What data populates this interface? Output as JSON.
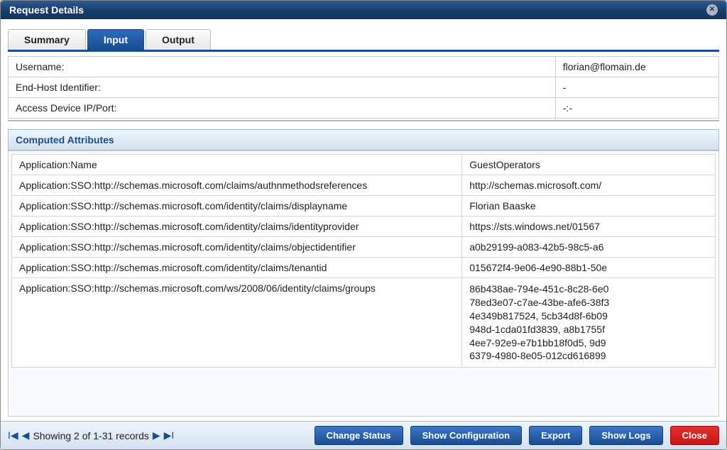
{
  "window": {
    "title": "Request Details"
  },
  "tabs": [
    {
      "label": "Summary",
      "active": false
    },
    {
      "label": "Input",
      "active": true
    },
    {
      "label": "Output",
      "active": false
    }
  ],
  "info": {
    "username_label": "Username:",
    "username_value": "florian@flomain.de",
    "endhost_label": "End-Host Identifier:",
    "endhost_value": "-",
    "device_label": "Access Device IP/Port:",
    "device_value": "-:-"
  },
  "section": {
    "computed_attributes": "Computed Attributes"
  },
  "attributes": [
    {
      "key": "Application:Name",
      "value": "GuestOperators"
    },
    {
      "key": "Application:SSO:http://schemas.microsoft.com/claims/authnmethodsreferences",
      "value": "http://schemas.microsoft.com/"
    },
    {
      "key": "Application:SSO:http://schemas.microsoft.com/identity/claims/displayname",
      "value": "Florian Baaske"
    },
    {
      "key": "Application:SSO:http://schemas.microsoft.com/identity/claims/identityprovider",
      "value": "https://sts.windows.net/01567"
    },
    {
      "key": "Application:SSO:http://schemas.microsoft.com/identity/claims/objectidentifier",
      "value": "a0b29199-a083-42b5-98c5-a6"
    },
    {
      "key": "Application:SSO:http://schemas.microsoft.com/identity/claims/tenantid",
      "value": "015672f4-9e06-4e90-88b1-50e"
    },
    {
      "key": "Application:SSO:http://schemas.microsoft.com/ws/2008/06/identity/claims/groups",
      "value": "86b438ae-794e-451c-8c28-6e0\n78ed3e07-c7ae-43be-afe6-38f3\n4e349b817524, 5cb34d8f-6b09\n948d-1cda01fd3839, a8b1755f\n4ee7-92e9-e7b1bb18f0d5, 9d9\n6379-4980-8e05-012cd616899"
    }
  ],
  "pager": {
    "text": "Showing 2 of 1-31 records"
  },
  "buttons": {
    "change_status": "Change Status",
    "show_config": "Show Configuration",
    "export": "Export",
    "show_logs": "Show Logs",
    "close": "Close"
  }
}
